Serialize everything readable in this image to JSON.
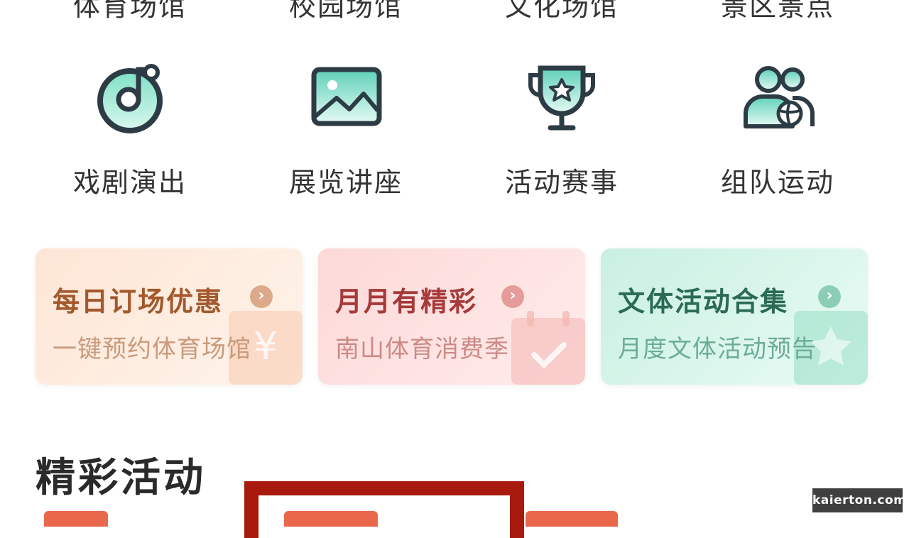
{
  "categories_top": [
    "体育场馆",
    "校园场馆",
    "文化场馆",
    "景区景点"
  ],
  "categories": [
    {
      "label": "戏剧演出",
      "icon": "music-disc-icon"
    },
    {
      "label": "展览讲座",
      "icon": "landscape-picture-icon"
    },
    {
      "label": "活动赛事",
      "icon": "trophy-icon"
    },
    {
      "label": "组队运动",
      "icon": "team-people-icon"
    }
  ],
  "promos": [
    {
      "title": "每日订场优惠",
      "subtitle": "一键预约体育场馆",
      "icon": "yen-tag-icon",
      "accent": "#a3582d"
    },
    {
      "title": "月月有精彩",
      "subtitle": "南山体育消费季",
      "icon": "calendar-check-icon",
      "accent": "#a63a3a"
    },
    {
      "title": "文体活动合集",
      "subtitle": "月度文体活动预告",
      "icon": "star-badge-icon",
      "accent": "#2b6a55"
    }
  ],
  "section": {
    "title": "精彩活动"
  },
  "watermark": "kaierton.com",
  "colors": {
    "icon_stroke": "#2d3b45",
    "icon_fill": "#5fd0b8",
    "highlight": "#a81a0e"
  }
}
